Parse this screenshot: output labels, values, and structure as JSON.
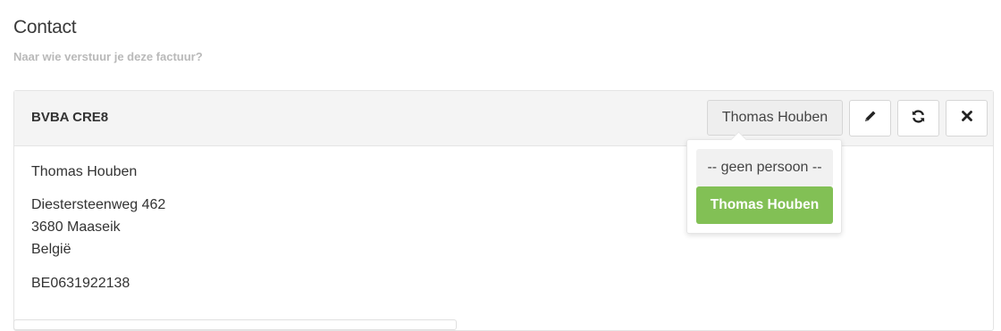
{
  "section": {
    "title": "Contact",
    "subtitle": "Naar wie verstuur je deze factuur?"
  },
  "card": {
    "company": "BVBA CRE8",
    "selected_person": "Thomas Houben",
    "actions": {
      "edit_icon": "pencil-icon",
      "refresh_icon": "refresh-icon",
      "remove_icon": "close-icon"
    },
    "contact_name": "Thomas Houben",
    "address_line1": "Diestersteenweg 462",
    "address_line2": "3680 Maaseik",
    "country": "België",
    "vat_number": "BE0631922138"
  },
  "dropdown": {
    "options": [
      {
        "label": "-- geen persoon --",
        "selected": false
      },
      {
        "label": "Thomas Houben",
        "selected": true
      }
    ],
    "selected_color": "#82c055"
  }
}
